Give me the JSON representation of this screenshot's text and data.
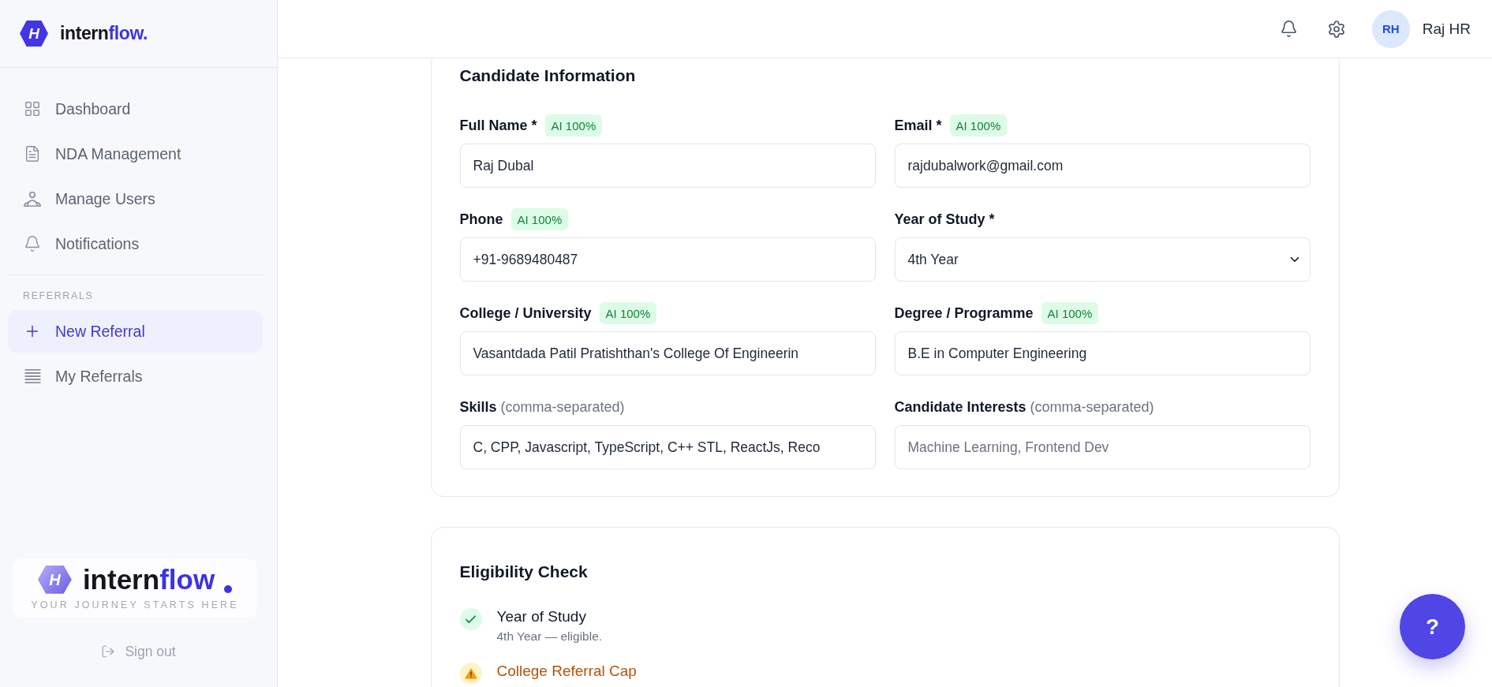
{
  "sidebar": {
    "brand": {
      "mark": "H",
      "name": "intern",
      "accent": "flow."
    },
    "nav": [
      {
        "label": "Dashboard",
        "selected": false
      },
      {
        "label": "NDA Management",
        "selected": false
      },
      {
        "label": "Manage Users",
        "selected": false
      },
      {
        "label": "Notifications",
        "selected": false
      }
    ],
    "section_label": "REFERRALS",
    "referral_nav": [
      {
        "label": "New Referral",
        "selected": true
      },
      {
        "label": "My Referrals",
        "selected": false
      }
    ],
    "promo": {
      "mark": "H",
      "name": "intern",
      "accent": "flow",
      "tagline": "YOUR JOURNEY STARTS HERE"
    },
    "sign_out": "Sign out"
  },
  "header": {
    "user": {
      "initials": "RH",
      "name": "Raj HR"
    }
  },
  "candidate_information": {
    "title": "Candidate Information",
    "fields": [
      {
        "kind": "text",
        "label": "Full Name *",
        "badge": "AI 100%",
        "value": "Raj Dubal"
      },
      {
        "kind": "text",
        "label": "Email *",
        "badge": "AI 100%",
        "value": "rajdubalwork@gmail.com"
      },
      {
        "kind": "text",
        "label": "Phone",
        "badge": "AI 100%",
        "value": "+91-9689480487"
      },
      {
        "kind": "select",
        "label": "Year of Study *",
        "value": "4th Year"
      },
      {
        "kind": "text",
        "label": "College / University",
        "badge": "AI 100%",
        "value": "Vasantdada Patil Pratishthan's College Of Engineerin"
      },
      {
        "kind": "text",
        "label": "Degree / Programme",
        "badge": "AI 100%",
        "value": "B.E in Computer Engineering"
      },
      {
        "kind": "text",
        "label": "Skills",
        "hint": "(comma-separated)",
        "value": "C, CPP, Javascript, TypeScript, C++ STL, ReactJs, Reco"
      },
      {
        "kind": "text",
        "label": "Candidate Interests",
        "hint": "(comma-separated)",
        "placeholder": "Machine Learning, Frontend Dev"
      }
    ]
  },
  "eligibility_check": {
    "title": "Eligibility Check",
    "items": [
      {
        "kind": "pass",
        "title": "Year of Study",
        "detail": "4th Year — eligible."
      },
      {
        "kind": "warning",
        "title": "College Referral Cap"
      }
    ]
  },
  "help_button": {
    "label": "?"
  }
}
